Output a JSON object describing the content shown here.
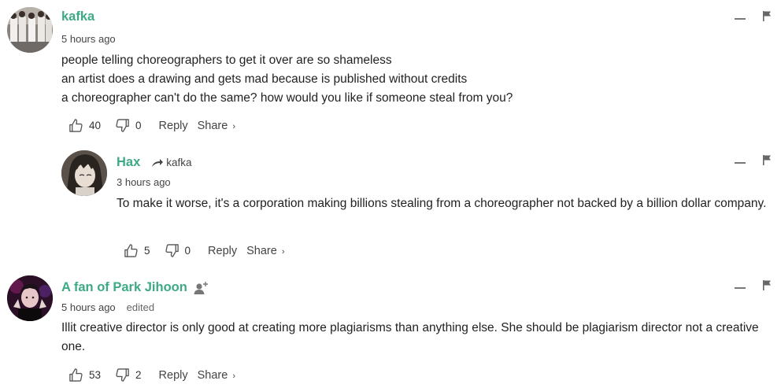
{
  "comments": [
    {
      "author": "kafka",
      "time": "5 hours ago",
      "lines": [
        "people telling choreographers to get it over are so shameless",
        "an artist does a drawing and gets mad because is published without credits",
        "a choreographer can't do the same? how would you like if someone steal from you?"
      ],
      "likes": "40",
      "dislikes": "0",
      "reply_label": "Reply",
      "share_label": "Share",
      "share_chevron": "›"
    },
    {
      "author": "Hax",
      "reply_to": "kafka",
      "time": "3 hours ago",
      "lines": [
        "To make it worse, it's a corporation making billions stealing from a choreographer not backed by a billion dollar company."
      ],
      "likes": "5",
      "dislikes": "0",
      "reply_label": "Reply",
      "share_label": "Share",
      "share_chevron": "›"
    },
    {
      "author": "A fan of Park Jihoon",
      "time": "5 hours ago",
      "edited": "edited",
      "lines": [
        "Illit creative director is only good at creating more plagiarisms than anything else. She should be plagiarism director not a creative one."
      ],
      "likes": "53",
      "dislikes": "2",
      "reply_label": "Reply",
      "share_label": "Share",
      "share_chevron": "›"
    }
  ],
  "colors": {
    "author": "#3daa85",
    "text": "#222222",
    "muted": "#444444"
  },
  "icons": [
    "thumbs-up-icon",
    "thumbs-down-icon",
    "collapse-icon",
    "flag-icon",
    "reply-arrow-icon",
    "follow-user-icon"
  ]
}
